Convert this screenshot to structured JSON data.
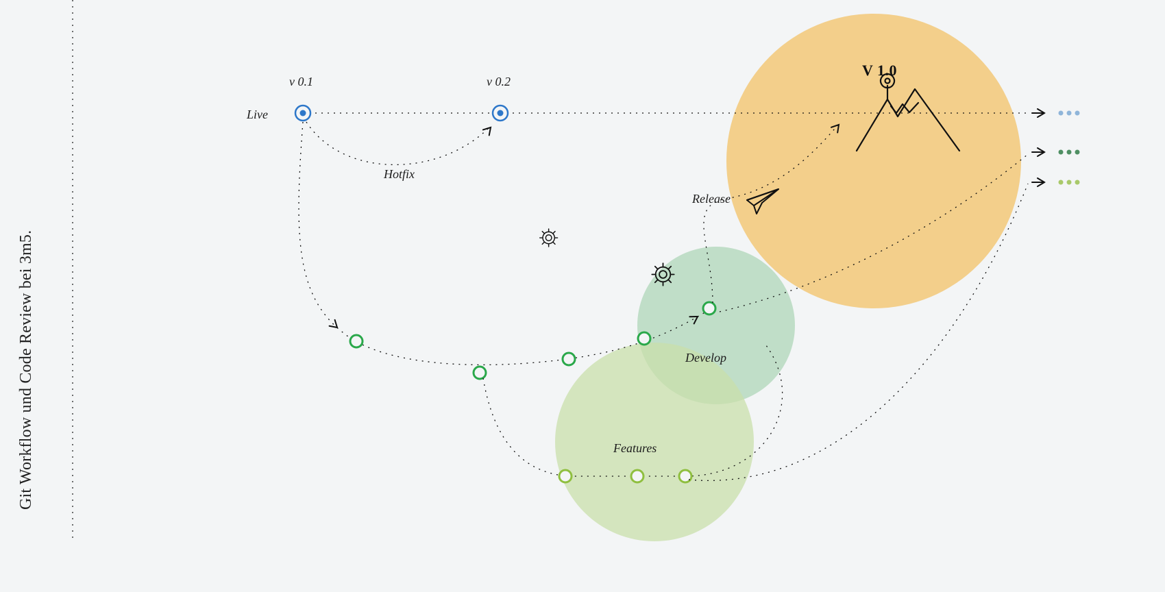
{
  "sidebar": {
    "title": "Git Workflow und Code Review bei 3m5."
  },
  "labels": {
    "live": "Live",
    "hotfix": "Hotfix",
    "develop": "Develop",
    "features": "Features",
    "release": "Release",
    "v01": "v 0.1",
    "v02": "v 0.2",
    "v10": "V 1.0"
  },
  "colors": {
    "liveBlue": "#2d77c9",
    "developGreen": "#2aa84a",
    "featureGreen": "#8fbf3f",
    "releaseOrange": "#f2c36b",
    "developFill": "#b6d9bf",
    "featureFill": "#c9dfab"
  },
  "chart_data": {
    "type": "diagram",
    "branches": [
      {
        "name": "Live",
        "color": "#2d77c9",
        "commits": [
          "v 0.1",
          "v 0.2",
          "V 1.0"
        ]
      },
      {
        "name": "Hotfix",
        "color": "#111111",
        "from": "v 0.1",
        "to": "v 0.2"
      },
      {
        "name": "Develop",
        "color": "#2aa84a",
        "commits": 5,
        "from": "v 0.1"
      },
      {
        "name": "Features",
        "color": "#8fbf3f",
        "commits": 3,
        "from": "Develop",
        "to": "Develop"
      },
      {
        "name": "Release",
        "color": "#111111",
        "from": "Develop",
        "to": "V 1.0"
      }
    ]
  }
}
